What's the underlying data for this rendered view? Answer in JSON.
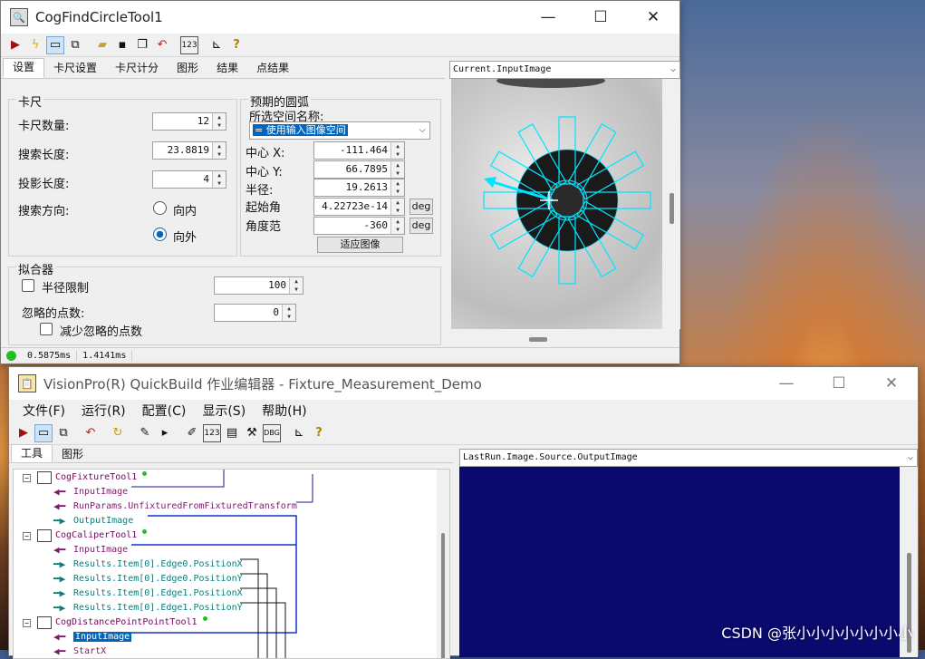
{
  "win1": {
    "title": "CogFindCircleTool1",
    "controls": {
      "minimize": "—",
      "maximize": "☐",
      "close": "✕"
    },
    "tabs": [
      "设置",
      "卡尺设置",
      "卡尺计分",
      "图形",
      "结果",
      "点结果"
    ],
    "caliper_group": {
      "title": "卡尺",
      "count_label": "卡尺数量:",
      "count_value": "12",
      "search_len_label": "搜索长度:",
      "search_len_value": "23.8819",
      "proj_len_label": "投影长度:",
      "proj_len_value": "4",
      "direction_label": "搜索方向:",
      "inward_label": "向内",
      "outward_label": "向外"
    },
    "arc_group": {
      "title": "预期的圆弧",
      "space_label": "所选空间名称:",
      "space_value": " = 使用输入图像空间",
      "center_x_label": "中心 X:",
      "center_x_value": "-111.464",
      "center_y_label": "中心 Y:",
      "center_y_value": "66.7895",
      "radius_label": "半径:",
      "radius_value": "19.2613",
      "start_angle_label": "起始角",
      "start_angle_value": "4.22723e-14",
      "angle_span_label": "角度范",
      "angle_span_value": "-360",
      "deg_label": "deg",
      "fit_button": "适应图像"
    },
    "fitter_group": {
      "title": "拟合器",
      "radius_limit_label": "半径限制",
      "radius_limit_value": "100",
      "ignore_label": "忽略的点数:",
      "ignore_value": "0",
      "reduce_label": "减少忽略的点数"
    },
    "image_combo": "Current.InputImage",
    "status": {
      "t1": "0.5875ms",
      "t2": "1.4141ms"
    }
  },
  "win2": {
    "title": "VisionPro(R) QuickBuild 作业编辑器 - Fixture_Measurement_Demo",
    "controls": {
      "minimize": "—",
      "maximize": "☐",
      "close": "✕"
    },
    "menu": [
      "文件(F)",
      "运行(R)",
      "配置(C)",
      "显示(S)",
      "帮助(H)"
    ],
    "tabs": [
      "工具",
      "图形"
    ],
    "image_combo": "LastRun.Image.Source.OutputImage",
    "tree": [
      {
        "text": "CogFixtureTool1",
        "kind": "tool",
        "expander": "−"
      },
      {
        "text": "InputImage",
        "kind": "in"
      },
      {
        "text": "RunParams.UnfixturedFromFixturedTransform",
        "kind": "in"
      },
      {
        "text": "OutputImage",
        "kind": "out"
      },
      {
        "text": "CogCaliperTool1",
        "kind": "tool",
        "expander": "−"
      },
      {
        "text": "InputImage",
        "kind": "in"
      },
      {
        "text": "Results.Item[0].Edge0.PositionX",
        "kind": "out"
      },
      {
        "text": "Results.Item[0].Edge0.PositionY",
        "kind": "out"
      },
      {
        "text": "Results.Item[0].Edge1.PositionX",
        "kind": "out"
      },
      {
        "text": "Results.Item[0].Edge1.PositionY",
        "kind": "out"
      },
      {
        "text": "CogDistancePointPointTool1",
        "kind": "tool",
        "expander": "−"
      },
      {
        "text": "InputImage",
        "kind": "in",
        "selected": true
      },
      {
        "text": "StartX",
        "kind": "in"
      }
    ]
  },
  "watermark": "CSDN @张小小小小小小小小",
  "colors": {
    "accent": "#0067c0",
    "tree_in": "#7a1a6a",
    "tree_out": "#0e7a78",
    "image_bg_dark": "#0a0a6e",
    "caliper": "#00e5ff"
  }
}
